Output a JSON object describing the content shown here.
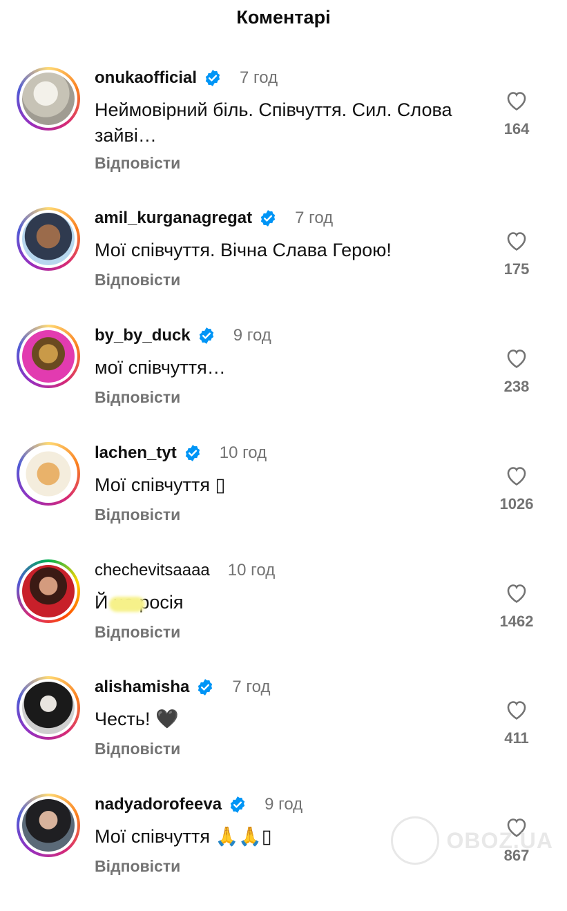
{
  "header": {
    "title": "Коментарі"
  },
  "reply_label": "Відповісти",
  "comments": [
    {
      "username": "onukaofficial",
      "verified": true,
      "time": "7 год",
      "text": "Неймовірний біль. Співчуття. Сил. Слова зайві…",
      "likes": "164",
      "avatar_color": "#d9d9d4"
    },
    {
      "username": "amil_kurganagregat",
      "verified": true,
      "time": "7 год",
      "text": "Мої співчуття. Вічна Слава Герою!",
      "likes": "175",
      "avatar_color": "#b7d7ee"
    },
    {
      "username": "by_by_duck",
      "verified": true,
      "time": "9 год",
      "text": "мої співчуття…",
      "likes": "238",
      "avatar_color": "#e23bb0"
    },
    {
      "username": "lachen_tyt",
      "verified": true,
      "time": "10 год",
      "text": "Мої співчуття ▯",
      "likes": "1026",
      "avatar_color": "#f0d9b5"
    },
    {
      "username": "chechevitsaaaa",
      "verified": false,
      "time": "10 год",
      "text": "Й    на росія",
      "likes": "1462",
      "avatar_color": "#7a1d1d"
    },
    {
      "username": "alishamisha",
      "verified": true,
      "time": "7 год",
      "text": "Честь! 🖤",
      "likes": "411",
      "avatar_color": "#2b2b2b"
    },
    {
      "username": "nadyadorofeeva",
      "verified": true,
      "time": "9 год",
      "text": "Мої співчуття 🙏🙏▯",
      "likes": "867",
      "avatar_color": "#3c4652"
    }
  ],
  "watermark": "OBOZ.UA",
  "colors": {
    "secondary": "#737373",
    "verified": "#0095f6"
  }
}
